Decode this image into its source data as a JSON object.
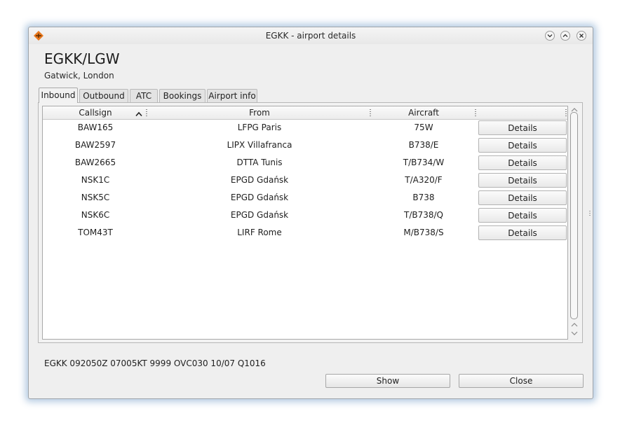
{
  "window": {
    "title": "EGKK - airport details",
    "icon": "app-logo-icon"
  },
  "airport": {
    "code": "EGKK/LGW",
    "name": "Gatwick, London"
  },
  "tabs": [
    {
      "label": "Inbound",
      "active": true
    },
    {
      "label": "Outbound",
      "active": false
    },
    {
      "label": "ATC",
      "active": false
    },
    {
      "label": "Bookings",
      "active": false
    },
    {
      "label": "Airport info",
      "active": false
    }
  ],
  "table": {
    "columns": [
      "Callsign",
      "From",
      "Aircraft",
      ""
    ],
    "sort_column": "Callsign",
    "sort_order": "ascending",
    "rows": [
      {
        "callsign": "BAW165",
        "from": "LFPG Paris",
        "aircraft": "75W",
        "action": "Details"
      },
      {
        "callsign": "BAW2597",
        "from": "LIPX Villafranca",
        "aircraft": "B738/E",
        "action": "Details"
      },
      {
        "callsign": "BAW2665",
        "from": "DTTA Tunis",
        "aircraft": "T/B734/W",
        "action": "Details"
      },
      {
        "callsign": "NSK1C",
        "from": "EPGD Gdańsk",
        "aircraft": "T/A320/F",
        "action": "Details"
      },
      {
        "callsign": "NSK5C",
        "from": "EPGD Gdańsk",
        "aircraft": "B738",
        "action": "Details"
      },
      {
        "callsign": "NSK6C",
        "from": "EPGD Gdańsk",
        "aircraft": "T/B738/Q",
        "action": "Details"
      },
      {
        "callsign": "TOM43T",
        "from": "LIRF Rome",
        "aircraft": "M/B738/S",
        "action": "Details"
      }
    ]
  },
  "metar": "EGKK 092050Z 07005KT 9999 OVC030 10/07 Q1016",
  "buttons": {
    "show": "Show",
    "close": "Close"
  },
  "colors": {
    "window_glow": "#5a8cbe",
    "background": "#efefef",
    "icon_accent": "#e8781e"
  }
}
